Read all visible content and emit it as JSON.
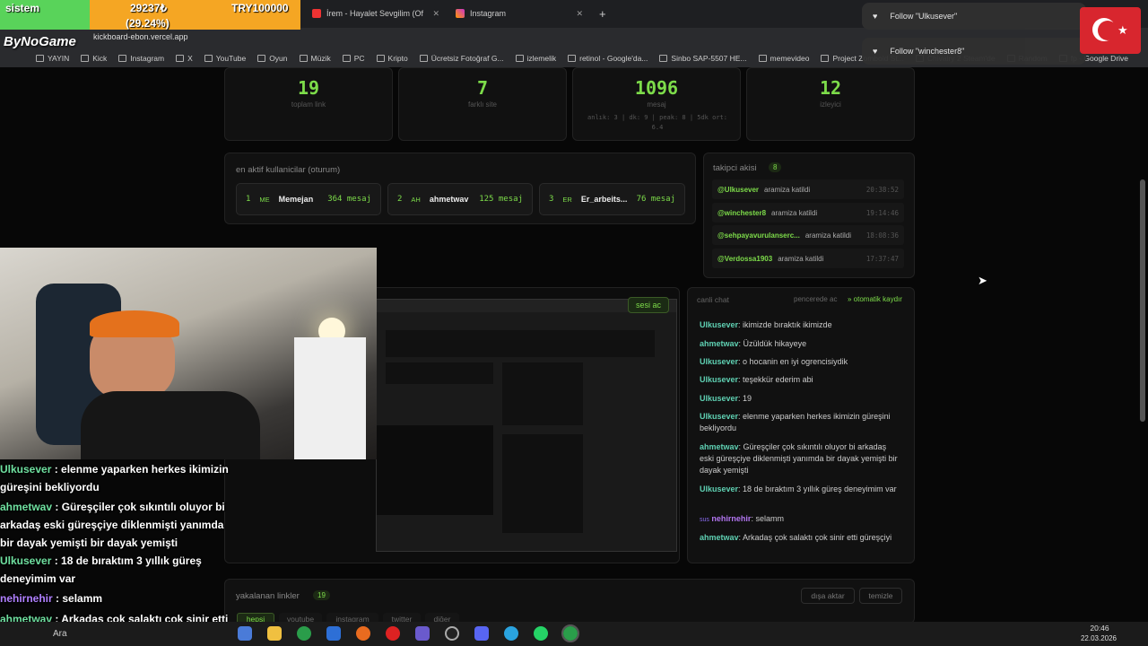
{
  "overlay_top": {
    "label": "sistem",
    "goal_amount": "29237₺",
    "goal_percent": "(29.24%)",
    "goal_target": "TRY100000",
    "channel": "ByNoGame"
  },
  "tabs": [
    {
      "label": "İrem - Hayalet Sevgilim (Of"
    },
    {
      "label": "Instagram"
    }
  ],
  "address": {
    "url": "kickboard-ebon.vercel.app"
  },
  "bookmarks": [
    "YAYIN",
    "Kick",
    "Instagram",
    "X",
    "YouTube",
    "Oyun",
    "Müzik",
    "PC",
    "Kripto",
    "Ücretsiz Fotoğraf G...",
    "izlemelik",
    "retinol - Google'da...",
    "Sinbo SAP-5507 HE...",
    "memevideo",
    "Project Zomboid St...",
    "Chivalry 2 Steam'de",
    "Random",
    "fp - Google Drive"
  ],
  "notifications": [
    {
      "text": "Follow \"Ulkusever\""
    },
    {
      "text": "Follow \"winchester8\""
    }
  ],
  "stats": [
    {
      "value": "19",
      "label": "toplam link"
    },
    {
      "value": "7",
      "label": "farklı site"
    },
    {
      "value": "1096",
      "label": "mesaj",
      "detail": "anlık: 3 | dk: 9 | peak: 8 | 5dk ort: 6.4"
    },
    {
      "value": "12",
      "label": "izleyici"
    }
  ],
  "active_users": {
    "title": "en aktif kullanicilar (oturum)",
    "items": [
      {
        "rank": "1",
        "initials": "ME",
        "name": "Memejan",
        "count": "364 mesaj"
      },
      {
        "rank": "2",
        "initials": "AH",
        "name": "ahmetwav",
        "count": "125 mesaj"
      },
      {
        "rank": "3",
        "initials": "ER",
        "name": "Er_arbeits...",
        "count": "76 mesaj"
      }
    ]
  },
  "followers": {
    "title": "takipci akisi",
    "count": "8",
    "items": [
      {
        "handle": "@Ulkusever",
        "action": "aramiza katildi",
        "time": "20:38:52"
      },
      {
        "handle": "@winchester8",
        "action": "aramiza katildi",
        "time": "19:14:46"
      },
      {
        "handle": "@sehpayavurulanserc...",
        "action": "aramiza katildi",
        "time": "18:08:36"
      },
      {
        "handle": "@Verdossa1903",
        "action": "aramiza katildi",
        "time": "17:37:47"
      }
    ]
  },
  "live_chat": {
    "title": "canli chat",
    "popout": "pencerede ac",
    "autoscroll": "otomatik kaydır",
    "sound": "sesi ac",
    "messages": [
      {
        "user": "Ulkusever",
        "text": "ikimizde bıraktık ikimizde"
      },
      {
        "user": "ahmetwav",
        "text": "Üzüldük hikayeye"
      },
      {
        "user": "Ulkusever",
        "text": "o hocanin en iyi ogrencisiydik"
      },
      {
        "user": "Ulkusever",
        "text": "teşekkür ederim abi"
      },
      {
        "user": "Ulkusever",
        "text": "19"
      },
      {
        "user": "Ulkusever",
        "text": "elenme yaparken herkes ikimizin güreşini bekliyordu"
      },
      {
        "user": "ahmetwav",
        "text": "Güreşçiler çok sıkıntılı oluyor bi arkadaş eski güreşçiye diklenmişti yanımda bir dayak yemişti bir dayak yemişti"
      },
      {
        "user": "Ulkusever",
        "text": "18 de bıraktım 3 yıllık güreş deneyimim var"
      },
      {
        "user": "nehirnehir",
        "text": "selamm",
        "badge": "sus"
      },
      {
        "user": "ahmetwav",
        "text": "Arkadaş çok salaktı çok sinir etti güreşçiyi"
      }
    ]
  },
  "links": {
    "title": "yakalanan linkler",
    "count": "19",
    "clear_label": "dışa aktar",
    "reset_label": "temizle",
    "filters": [
      "hepsi",
      "youtube",
      "instagram",
      "twitter",
      "diğer"
    ]
  },
  "stream_overlay_chat": [
    {
      "user": "Ulkusever",
      "text": "elenme yaparken herkes ikimizin güreşini bekliyordu"
    },
    {
      "user": "ahmetwav",
      "text": "Güreşçiler çok sıkıntılı oluyor bi arkadaş eski güreşçiye diklenmişti yanımda bir dayak yemişti bir dayak yemişti"
    },
    {
      "user": "Ulkusever",
      "text": "18 de bıraktım 3 yıllık güreş deneyimim var"
    },
    {
      "user": "nehirnehir",
      "text": "selamm"
    },
    {
      "user": "ahmetwav",
      "text": "Arkadaş çok salaktı çok sinir etti güreşçiyi"
    }
  ],
  "taskbar": {
    "search": "Ara",
    "time": "20:46",
    "date": "22.03.2026"
  },
  "colors": {
    "accent": "#7ddc4a",
    "name": "#5fd1b3",
    "purple": "#b175f0",
    "bg": "#070707"
  }
}
